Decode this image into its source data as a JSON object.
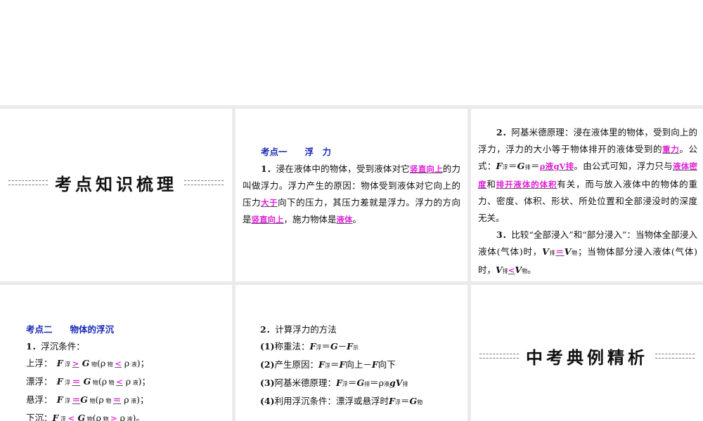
{
  "titles": {
    "knowledge": "考点知识梳理",
    "examples": "中考典例精析"
  },
  "panel2": [
    [
      {
        "k": "h",
        "t": "考点一　　浮　力"
      }
    ],
    [
      {
        "k": "b",
        "t": "1．"
      },
      {
        "t": "浸在液体中的物体，受到液体对它"
      },
      {
        "k": "a",
        "t": "竖直向上"
      },
      {
        "t": "的力叫做浮力。浮力产生的原因：物体受到液体对它向上的压力"
      },
      {
        "k": "a",
        "t": "大于"
      },
      {
        "t": "向下的压力，其压力差就是浮力。浮力的方向是"
      },
      {
        "k": "a",
        "t": "竖直向上"
      },
      {
        "t": "，施力物体是"
      },
      {
        "k": "a",
        "t": "液体"
      },
      {
        "t": "。"
      }
    ]
  ],
  "panel3": [
    [
      {
        "k": "b",
        "t": "2．"
      },
      {
        "t": "阿基米德原理：浸在液体里的物体，受到向上的浮力，浮力的大小等于物体排开的液体受到的"
      },
      {
        "k": "a",
        "t": "重力"
      },
      {
        "t": "。公式："
      },
      {
        "k": "i",
        "t": "F"
      },
      {
        "k": "s",
        "t": "浮"
      },
      {
        "t": "＝"
      },
      {
        "k": "i",
        "t": "G"
      },
      {
        "k": "s",
        "t": "排"
      },
      {
        "t": "＝"
      },
      {
        "k": "a",
        "t": "ρ液gV排"
      },
      {
        "t": "。由公式可知，浮力只与"
      },
      {
        "k": "a",
        "t": "液体密度"
      },
      {
        "t": "和"
      },
      {
        "k": "a",
        "t": "排开液体的体积"
      },
      {
        "t": "有关，而与放入液体中的物体的重力、密度、体积、形状、所处位置和全部浸没时的深度无关。"
      }
    ],
    [
      {
        "k": "b",
        "t": "3．"
      },
      {
        "t": "比较“全部浸入”和“部分浸入”：当物体全部浸入液体(气体)时，"
      },
      {
        "k": "i",
        "t": "V"
      },
      {
        "k": "s",
        "t": "排"
      },
      {
        "k": "a",
        "t": "＝"
      },
      {
        "k": "i",
        "t": "V"
      },
      {
        "k": "s",
        "t": "物"
      },
      {
        "t": "；当物体部分浸入液体(气体)时，"
      },
      {
        "k": "i",
        "t": "V"
      },
      {
        "k": "s",
        "t": "排"
      },
      {
        "k": "a",
        "t": "<"
      },
      {
        "k": "i",
        "t": "V"
      },
      {
        "k": "s",
        "t": "物"
      },
      {
        "t": "。"
      }
    ]
  ],
  "panel4": [
    [
      {
        "k": "h",
        "t": "考点二　　物体的浮沉"
      }
    ],
    [
      {
        "k": "b",
        "t": "1．"
      },
      {
        "t": "浮沉条件："
      }
    ],
    [
      {
        "t": "上浮：　"
      },
      {
        "k": "i",
        "t": "F"
      },
      {
        "k": "s",
        "t": " 浮 "
      },
      {
        "k": "a",
        "t": ">"
      },
      {
        "k": "i",
        "t": " G"
      },
      {
        "k": "s",
        "t": " 物"
      },
      {
        "t": "(ρ"
      },
      {
        "k": "s",
        "t": " 物 "
      },
      {
        "k": "a",
        "t": "<"
      },
      {
        "t": " ρ"
      },
      {
        "k": "s",
        "t": " 液"
      },
      {
        "t": ")；"
      }
    ],
    [
      {
        "t": "漂浮：　"
      },
      {
        "k": "i",
        "t": "F"
      },
      {
        "k": "s",
        "t": " 浮 "
      },
      {
        "k": "a",
        "t": "＝"
      },
      {
        "k": "i",
        "t": " G"
      },
      {
        "k": "s",
        "t": " 物"
      },
      {
        "t": "(ρ"
      },
      {
        "k": "s",
        "t": " 物 "
      },
      {
        "k": "a",
        "t": "<"
      },
      {
        "t": " ρ"
      },
      {
        "k": "s",
        "t": " 液"
      },
      {
        "t": ")；"
      }
    ],
    [
      {
        "t": "悬浮：　"
      },
      {
        "k": "i",
        "t": "F"
      },
      {
        "k": "s",
        "t": " 浮 "
      },
      {
        "k": "a",
        "t": "＝"
      },
      {
        "k": "i",
        "t": "G"
      },
      {
        "k": "s",
        "t": " 物"
      },
      {
        "t": "(ρ"
      },
      {
        "k": "s",
        "t": " 物 "
      },
      {
        "k": "a",
        "t": "＝"
      },
      {
        "t": " ρ"
      },
      {
        "k": "s",
        "t": " 液"
      },
      {
        "t": ")；"
      }
    ],
    [
      {
        "t": "下沉："
      },
      {
        "k": "i",
        "t": "F"
      },
      {
        "k": "s",
        "t": " 浮 "
      },
      {
        "k": "a",
        "t": "<"
      },
      {
        "k": "i",
        "t": " G"
      },
      {
        "k": "s",
        "t": " 物"
      },
      {
        "t": "(ρ"
      },
      {
        "k": "s",
        "t": " 物 "
      },
      {
        "k": "a",
        "t": ">"
      },
      {
        "t": " ρ"
      },
      {
        "k": "s",
        "t": " 液"
      },
      {
        "t": ")。"
      }
    ]
  ],
  "panel5": [
    [
      {
        "k": "b",
        "t": "2．"
      },
      {
        "t": "计算浮力的方法"
      }
    ],
    [
      {
        "k": "b",
        "t": "(1)"
      },
      {
        "t": "称重法："
      },
      {
        "k": "i",
        "t": "F"
      },
      {
        "k": "s",
        "t": "浮"
      },
      {
        "t": "＝"
      },
      {
        "k": "i",
        "t": "G"
      },
      {
        "t": "－"
      },
      {
        "k": "i",
        "t": "F"
      },
      {
        "k": "s",
        "t": "示"
      }
    ],
    [
      {
        "k": "b",
        "t": "(2)"
      },
      {
        "t": "产生原因："
      },
      {
        "k": "i",
        "t": "F"
      },
      {
        "k": "s",
        "t": "浮"
      },
      {
        "t": "＝"
      },
      {
        "k": "i",
        "t": "F"
      },
      {
        "t": "向上－"
      },
      {
        "k": "i",
        "t": "F"
      },
      {
        "t": "向下"
      }
    ],
    [
      {
        "k": "b",
        "t": "(3)"
      },
      {
        "t": "阿基米德原理："
      },
      {
        "k": "i",
        "t": "F"
      },
      {
        "k": "s",
        "t": "浮"
      },
      {
        "t": "＝"
      },
      {
        "k": "i",
        "t": "G"
      },
      {
        "k": "s",
        "t": "排"
      },
      {
        "t": "＝ρ"
      },
      {
        "k": "s",
        "t": "液"
      },
      {
        "k": "i",
        "t": "gV"
      },
      {
        "k": "s",
        "t": "排"
      }
    ],
    [
      {
        "k": "b",
        "t": "(4)"
      },
      {
        "t": "利用浮沉条件：漂浮或悬浮时"
      },
      {
        "k": "i",
        "t": "F"
      },
      {
        "k": "s",
        "t": "浮"
      },
      {
        "t": "＝"
      },
      {
        "k": "i",
        "t": "G"
      },
      {
        "k": "s",
        "t": "物"
      }
    ]
  ]
}
